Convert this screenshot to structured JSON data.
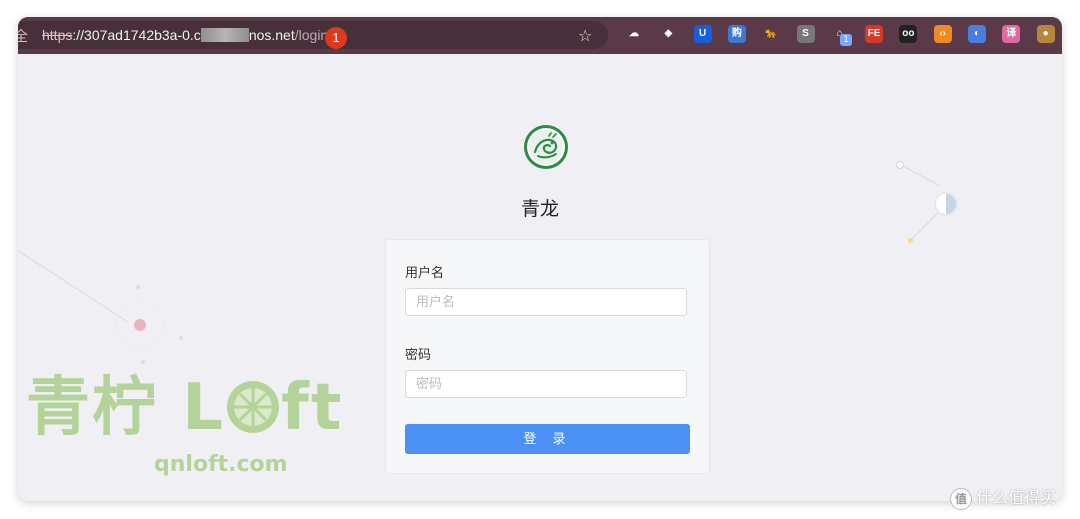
{
  "browser": {
    "back_glyph": "全",
    "url_scheme": "https",
    "url_sep": "://",
    "url_host_start": "307ad1742b3a-0.c",
    "url_host_end": "nos.net",
    "url_path": "/login",
    "step_badge": "1",
    "bookmark_icon": "star-icon",
    "extension_count": "1",
    "extensions": [
      {
        "name": "cloud-icon",
        "glyph": "☁",
        "color": "#5a3a48"
      },
      {
        "name": "shield-ext-icon",
        "glyph": "◈",
        "color": "#5a3a48"
      },
      {
        "name": "bitwarden-icon",
        "glyph": "U",
        "color": "#175ddc"
      },
      {
        "name": "shopping-icon",
        "glyph": "购",
        "color": "#3e77d6"
      },
      {
        "name": "cat-ext-icon",
        "glyph": "🐆",
        "color": "#5a3a48"
      },
      {
        "name": "s-ext-icon",
        "glyph": "S",
        "color": "#777777"
      },
      {
        "name": "home-ext-icon",
        "glyph": "⌂",
        "color": "#5a3a48"
      },
      {
        "name": "fe-ext-icon",
        "glyph": "FE",
        "color": "#d33a2c"
      },
      {
        "name": "glasses-ext-icon",
        "glyph": "oo",
        "color": "#222222"
      },
      {
        "name": "code-ext-icon",
        "glyph": "‹›",
        "color": "#f08a24"
      },
      {
        "name": "chrome-ext-icon",
        "glyph": "◐",
        "color": "#4c7ce0"
      },
      {
        "name": "translate-ext-icon",
        "glyph": "译",
        "color": "#e06aa0"
      },
      {
        "name": "cookie-ext-icon",
        "glyph": "●",
        "color": "#b8863b"
      }
    ]
  },
  "app": {
    "title": "青龙",
    "username_label": "用户名",
    "username_placeholder": "用户名",
    "password_label": "密码",
    "password_placeholder": "密码",
    "login_button": "登 录",
    "accent": "#4a90f5"
  },
  "watermark": {
    "text": "青柠 L",
    "text_end": "ft",
    "url": "qnloft.com",
    "color": "#a9cf8a"
  },
  "corner_mark": {
    "glyph": "值",
    "text": "什么值得买"
  }
}
